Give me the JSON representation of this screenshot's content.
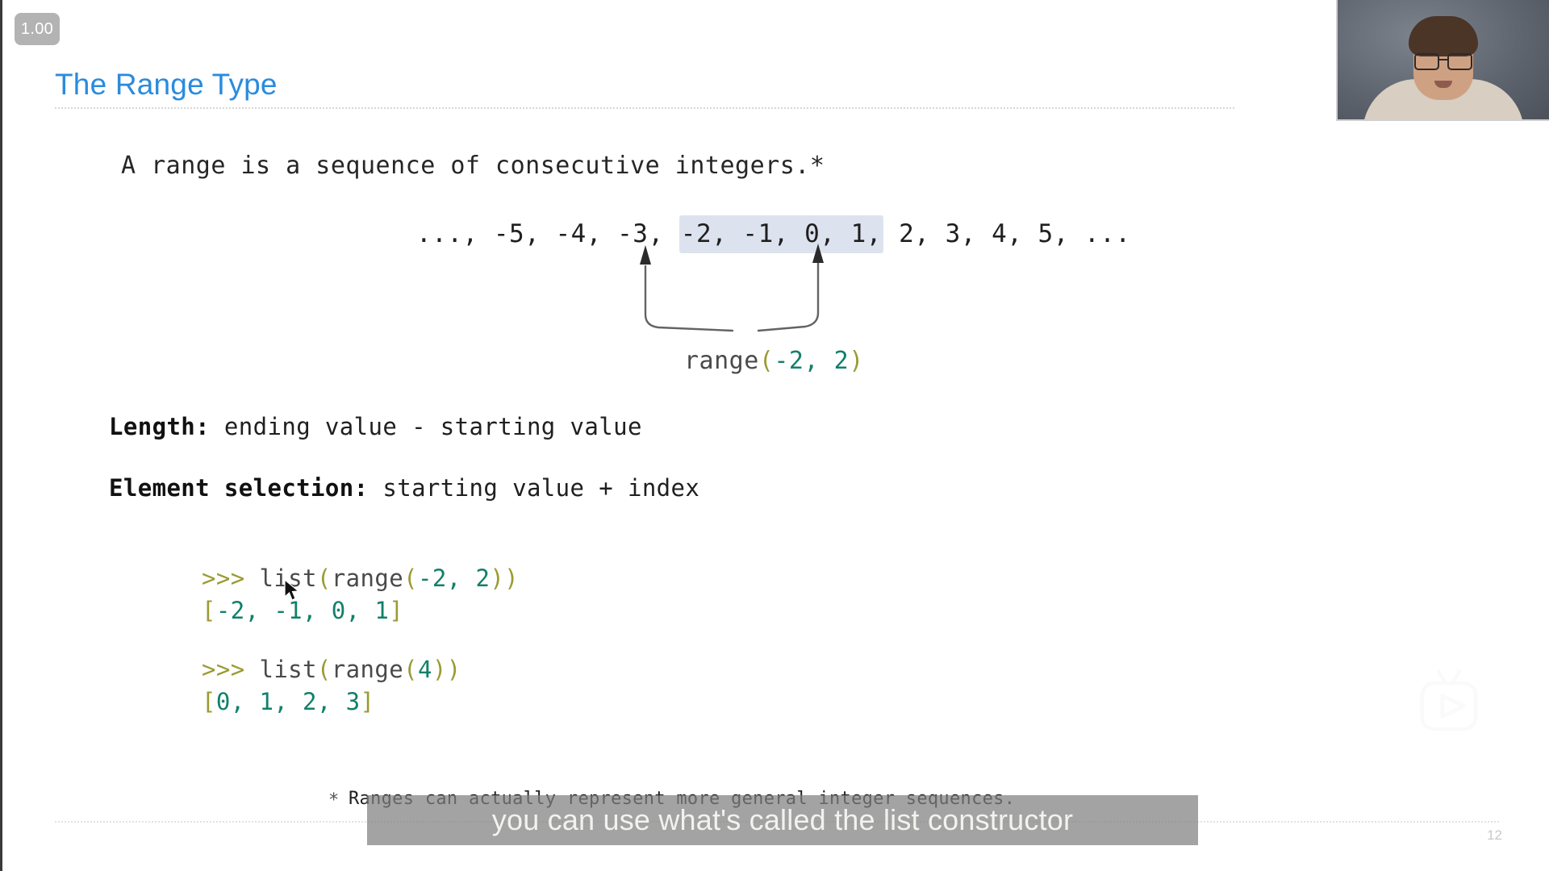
{
  "player": {
    "speed_badge": "1.00",
    "watermark_icon": "tv-play-icon"
  },
  "slide": {
    "title": "The Range Type",
    "page_number": "12",
    "lead_line": "A range is a sequence of consecutive integers.*",
    "sequence": {
      "prefix": "..., -5, -4, -3, ",
      "highlighted": "-2, -1, 0, 1,",
      "suffix": " 2, 3, 4, 5, ...",
      "highlight_color": "#dde3ee"
    },
    "range_call": {
      "name": "range",
      "open_paren": "(",
      "arg1": "-2",
      "comma": ", ",
      "arg2": "2",
      "close_paren": ")"
    },
    "definitions": [
      {
        "label": "Length:",
        "text": " ending value - starting value"
      },
      {
        "label": "Element selection:",
        "text": " starting value + index"
      }
    ],
    "repl": [
      {
        "prompt": ">>> ",
        "code_pre": "list",
        "code_open": "(",
        "code_fn": "range",
        "code_open2": "(",
        "code_arg1": "-2",
        "code_comma": ", ",
        "code_arg2": "2",
        "code_close": "))",
        "output_open": "[",
        "output_values": "-2, -1, 0, 1",
        "output_close": "]"
      },
      {
        "prompt": ">>> ",
        "code_pre": "list",
        "code_open": "(",
        "code_fn": "range",
        "code_open2": "(",
        "code_arg1": "4",
        "code_comma": "",
        "code_arg2": "",
        "code_close": "))",
        "output_open": "[",
        "output_values": "0, 1, 2, 3",
        "output_close": "]"
      }
    ],
    "footnote": {
      "marker": "*",
      "text": "Ranges can actually represent more general integer sequences."
    }
  },
  "caption": {
    "text": "you can use what's called the list constructor"
  },
  "colors": {
    "title_blue": "#2a8bdd",
    "token_number_teal": "#12806a",
    "token_punct_olive": "#9a9b33",
    "token_name_gray": "#4a4a4a",
    "highlight_blue_gray": "#dde3ee",
    "caption_bar": "#808080"
  }
}
